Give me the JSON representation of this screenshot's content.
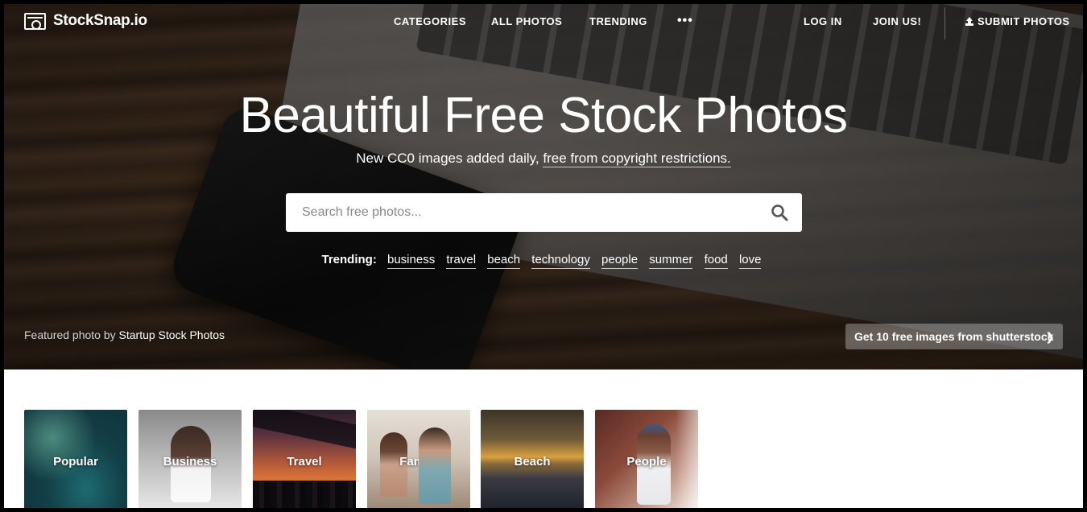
{
  "brand": {
    "name": "StockSnap.io",
    "icon": "camera-icon"
  },
  "nav": {
    "categories": "CATEGORIES",
    "all_photos": "ALL PHOTOS",
    "trending": "TRENDING",
    "more": "•••",
    "log_in": "LOG IN",
    "join": "JOIN US!",
    "submit": "SUBMIT PHOTOS"
  },
  "hero": {
    "title": "Beautiful Free Stock Photos",
    "subtitle_prefix": "New CC0 images added daily,",
    "subtitle_link": "free from copyright restrictions.",
    "search_placeholder": "Search free photos...",
    "trending_label": "Trending:",
    "trending_tags": [
      "business",
      "travel",
      "beach",
      "technology",
      "people",
      "summer",
      "food",
      "love"
    ],
    "featured_prefix": "Featured photo by",
    "featured_author": "Startup Stock Photos",
    "shutterstock_cta": "Get 10 free images from shutterstock"
  },
  "categories": [
    "Popular",
    "Business",
    "Travel",
    "Family",
    "Beach",
    "People"
  ]
}
